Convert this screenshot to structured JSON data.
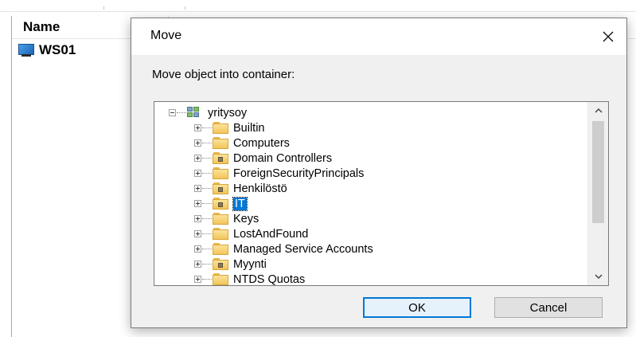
{
  "background_list": {
    "column_header": "Name",
    "rows": [
      {
        "label": "WS01",
        "icon": "computer-icon"
      }
    ]
  },
  "dialog": {
    "title": "Move",
    "close_icon": "close-icon",
    "prompt": "Move object into container:",
    "tree": {
      "root": {
        "label": "yritysoy",
        "icon": "domain-icon",
        "expanded": true
      },
      "children": [
        {
          "label": "Builtin",
          "icon": "folder-icon",
          "selected": false
        },
        {
          "label": "Computers",
          "icon": "folder-icon",
          "selected": false
        },
        {
          "label": "Domain Controllers",
          "icon": "ou-folder-icon",
          "selected": false
        },
        {
          "label": "ForeignSecurityPrincipals",
          "icon": "folder-icon",
          "selected": false
        },
        {
          "label": "Henkilöstö",
          "icon": "ou-folder-icon",
          "selected": false
        },
        {
          "label": "IT",
          "icon": "ou-folder-icon",
          "selected": true
        },
        {
          "label": "Keys",
          "icon": "folder-icon",
          "selected": false
        },
        {
          "label": "LostAndFound",
          "icon": "folder-icon",
          "selected": false
        },
        {
          "label": "Managed Service Accounts",
          "icon": "folder-icon",
          "selected": false
        },
        {
          "label": "Myynti",
          "icon": "ou-folder-icon",
          "selected": false
        },
        {
          "label": "NTDS Quotas",
          "icon": "folder-icon",
          "selected": false
        }
      ]
    },
    "buttons": {
      "ok": "OK",
      "cancel": "Cancel"
    }
  },
  "colors": {
    "selection": "#0078d7",
    "dialog_client": "#f0f0f0",
    "folder": "#f2c55a"
  }
}
